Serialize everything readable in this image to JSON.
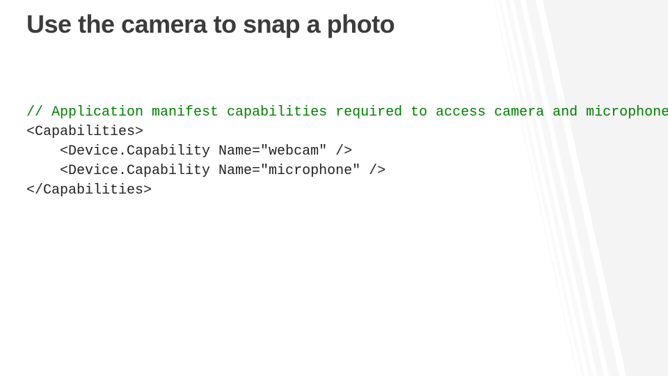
{
  "title": "Use the camera to snap a photo",
  "code": {
    "comment_line": "// Application manifest capabilities required to access camera and microphone",
    "line2": "<Capabilities>",
    "line3": "    <Device.Capability Name=\"webcam\" />",
    "line4": "    <Device.Capability Name=\"microphone\" />",
    "line5": "</Capabilities>"
  }
}
